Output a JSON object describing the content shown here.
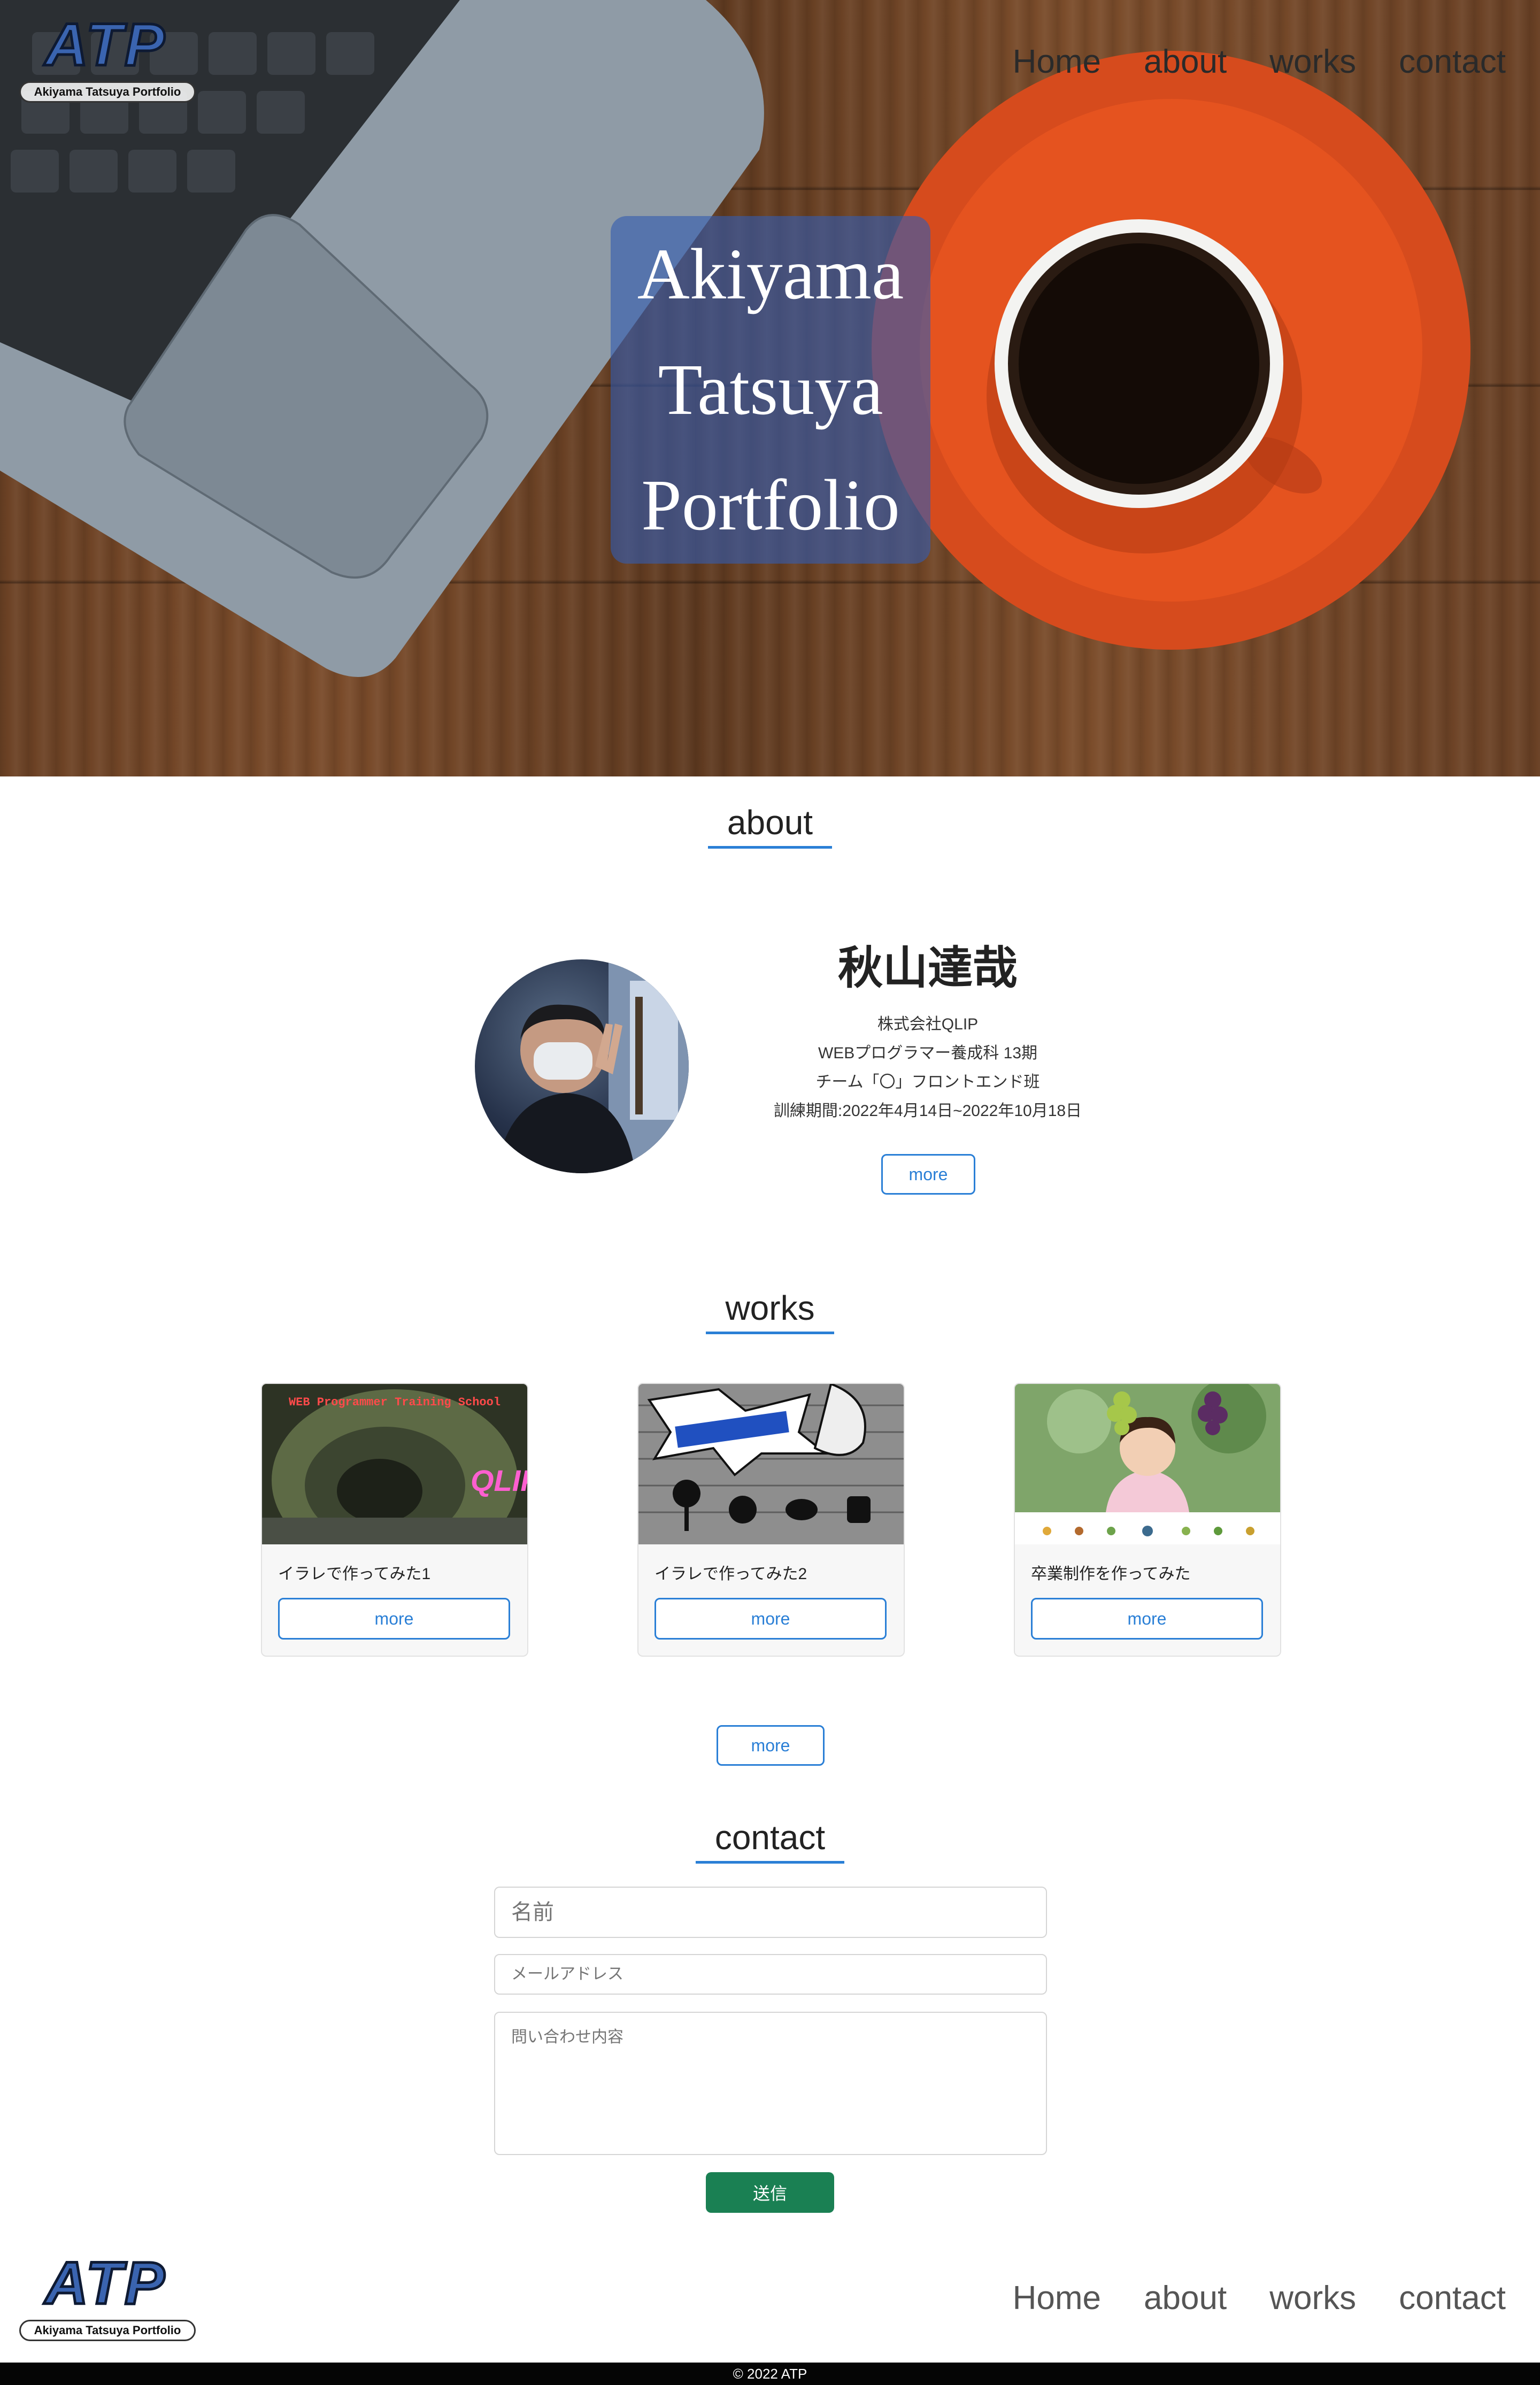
{
  "brand": {
    "logo_text": "ATP",
    "logo_subtitle": "Akiyama Tatsuya Portfolio"
  },
  "nav": {
    "items": [
      "Home",
      "about",
      "works",
      "contact"
    ]
  },
  "hero": {
    "title_lines": [
      "Akiyama",
      "Tatsuya",
      "Portfolio"
    ]
  },
  "about": {
    "heading": "about",
    "name": "秋山達哉",
    "lines": [
      "株式会社QLIP",
      "WEBプログラマー養成科 13期",
      "チーム「〇」フロントエンド班",
      "訓練期間:2022年4月14日~2022年10月18日"
    ],
    "more_label": "more"
  },
  "works": {
    "heading": "works",
    "items": [
      {
        "caption": "イラレで作ってみた1",
        "more_label": "more",
        "thumb_text": "WEB Programmer Training School",
        "thumb_badge": "QLIP"
      },
      {
        "caption": "イラレで作ってみた2",
        "more_label": "more"
      },
      {
        "caption": "卒業制作を作ってみた",
        "more_label": "more"
      }
    ],
    "more_label": "more"
  },
  "contact": {
    "heading": "contact",
    "name_placeholder": "名前",
    "email_placeholder": "メールアドレス",
    "message_placeholder": "問い合わせ内容",
    "submit_label": "送信"
  },
  "footer": {
    "copyright": "© 2022 ATP"
  },
  "colors": {
    "accent": "#2a7fd6",
    "submit": "#1a8053",
    "hero_box": "#345cb0",
    "footer_bar": "#050505"
  }
}
